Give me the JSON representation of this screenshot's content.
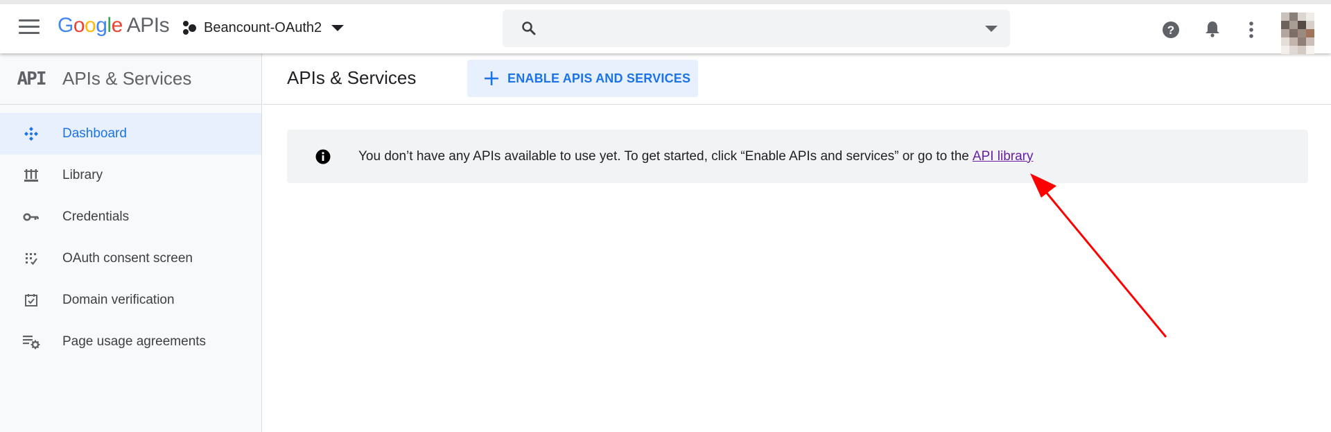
{
  "header": {
    "logo_google": "Google",
    "logo_apis": "APIs",
    "project_name": "Beancount-OAuth2",
    "search_placeholder": "",
    "icons": [
      "menu-icon",
      "project-icon",
      "search-icon",
      "help-icon",
      "bell-icon",
      "more-vert-icon"
    ]
  },
  "sidebar": {
    "badge": "API",
    "title": "APIs & Services",
    "items": [
      {
        "label": "Dashboard",
        "icon": "dashboard-icon",
        "active": true
      },
      {
        "label": "Library",
        "icon": "library-icon",
        "active": false
      },
      {
        "label": "Credentials",
        "icon": "key-icon",
        "active": false
      },
      {
        "label": "OAuth consent screen",
        "icon": "consent-icon",
        "active": false
      },
      {
        "label": "Domain verification",
        "icon": "check-box-icon",
        "active": false
      },
      {
        "label": "Page usage agreements",
        "icon": "settings-list-icon",
        "active": false
      }
    ]
  },
  "main": {
    "title": "APIs & Services",
    "enable_button": "ENABLE APIS AND SERVICES",
    "notice": {
      "message": "You don’t have any APIs available to use yet. To get started, click “Enable APIs and services” or go to the",
      "link": "API library"
    }
  },
  "colors": {
    "accent": "#1a73e8",
    "active_bg": "#e8f0fe",
    "link_visited": "#681da8",
    "annotation_arrow": "#ff0000"
  }
}
